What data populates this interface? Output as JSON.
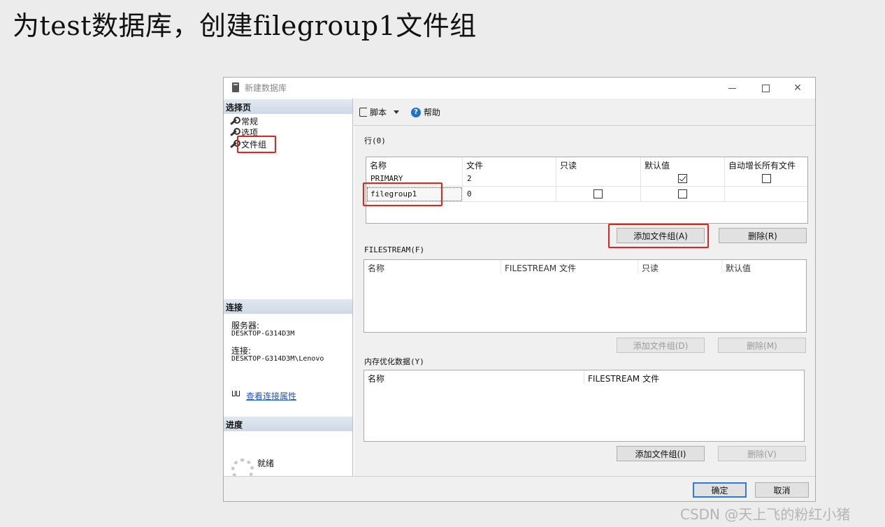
{
  "slide": {
    "title": "为test数据库，创建filegroup1文件组"
  },
  "window": {
    "title": "新建数据库",
    "controls": {
      "minimize": "minimize-icon",
      "maximize": "maximize-icon",
      "close": "✕"
    }
  },
  "left": {
    "select_page_header": "选择页",
    "pages": [
      {
        "label": "常规",
        "icon": "wrench-icon"
      },
      {
        "label": "选项",
        "icon": "wrench-icon"
      },
      {
        "label": "文件组",
        "icon": "wrench-icon"
      }
    ],
    "connection_header": "连接",
    "server_label": "服务器:",
    "server_value": "DESKTOP-G314D3M",
    "connection_label": "连接:",
    "connection_value": "DESKTOP-G314D3M\\Lenovo",
    "view_link": "查看连接属性",
    "progress_header": "进度",
    "progress_status": "就绪"
  },
  "toolbar": {
    "script_label": "脚本",
    "help_label": "帮助"
  },
  "rows_section": {
    "label": "行(0)",
    "columns": [
      "名称",
      "文件",
      "只读",
      "默认值",
      "自动增长所有文件"
    ],
    "rows": [
      {
        "name": "PRIMARY",
        "files": "2",
        "readonly": null,
        "default": true,
        "autogrow": false
      },
      {
        "name": "filegroup1",
        "files": "0",
        "readonly": false,
        "default": false,
        "autogrow": null
      }
    ],
    "add_button": "添加文件组(A)",
    "delete_button": "删除(R)"
  },
  "filestream_section": {
    "label": "FILESTREAM(F)",
    "columns": [
      "名称",
      "FILESTREAM 文件",
      "只读",
      "默认值"
    ],
    "add_button": "添加文件组(D)",
    "delete_button": "删除(M)"
  },
  "memory_section": {
    "label": "内存优化数据(Y)",
    "columns": [
      "名称",
      "FILESTREAM 文件"
    ],
    "add_button": "添加文件组(I)",
    "delete_button": "删除(V)"
  },
  "footer": {
    "ok_button": "确定",
    "cancel_button": "取消"
  },
  "watermark": "CSDN @天上飞的粉红小猪",
  "colors": {
    "highlight": "#e0241b",
    "link": "#1a55c9",
    "primary_border": "#2d7bd4"
  }
}
